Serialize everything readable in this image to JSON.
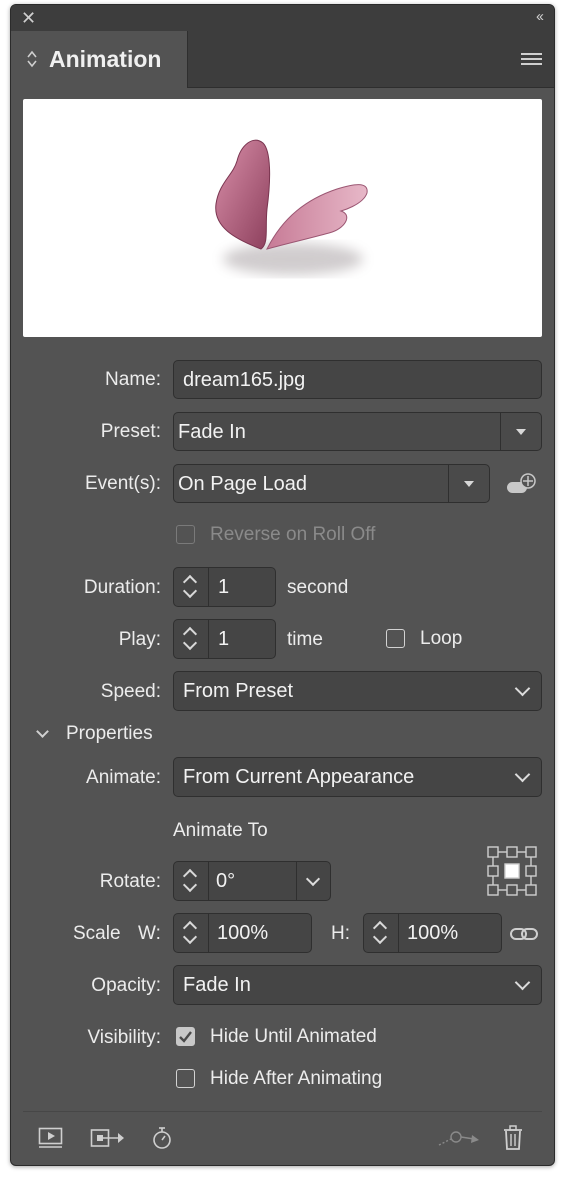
{
  "panel": {
    "title": "Animation",
    "close_glyph": "✕",
    "collapse_glyph": "‹‹"
  },
  "fields": {
    "name_label": "Name:",
    "name_value": "dream165.jpg",
    "preset_label": "Preset:",
    "preset_value": "Fade In",
    "events_label": "Event(s):",
    "events_value": "On Page Load",
    "reverse_label": "Reverse on Roll Off",
    "duration_label": "Duration:",
    "duration_value": "1",
    "duration_unit": "second",
    "play_label": "Play:",
    "play_value": "1",
    "play_unit": "time",
    "loop_label": "Loop",
    "speed_label": "Speed:",
    "speed_value": "From Preset"
  },
  "properties": {
    "section_label": "Properties",
    "animate_label": "Animate:",
    "animate_value": "From Current Appearance",
    "animate_to_label": "Animate To",
    "rotate_label": "Rotate:",
    "rotate_value": "0°",
    "scale_label": "Scale",
    "w_label": "W:",
    "w_value": "100%",
    "h_label": "H:",
    "h_value": "100%",
    "opacity_label": "Opacity:",
    "opacity_value": "Fade In",
    "visibility_label": "Visibility:",
    "hide_until_label": "Hide Until Animated",
    "hide_until_checked": true,
    "hide_after_label": "Hide After Animating",
    "hide_after_checked": false
  },
  "icons": {
    "preview": "preview-play-icon",
    "convert": "convert-to-motion-path-icon",
    "timing": "timing-stopwatch-icon",
    "motion_path": "motion-path-icon",
    "delete": "trash-icon",
    "event_add": "add-event-icon",
    "proxy": "reference-point-proxy-icon",
    "constrain": "link-icon"
  },
  "colors": {
    "panel_bg": "#535353",
    "field_bg": "#454545",
    "butterfly": "#b8647f"
  }
}
